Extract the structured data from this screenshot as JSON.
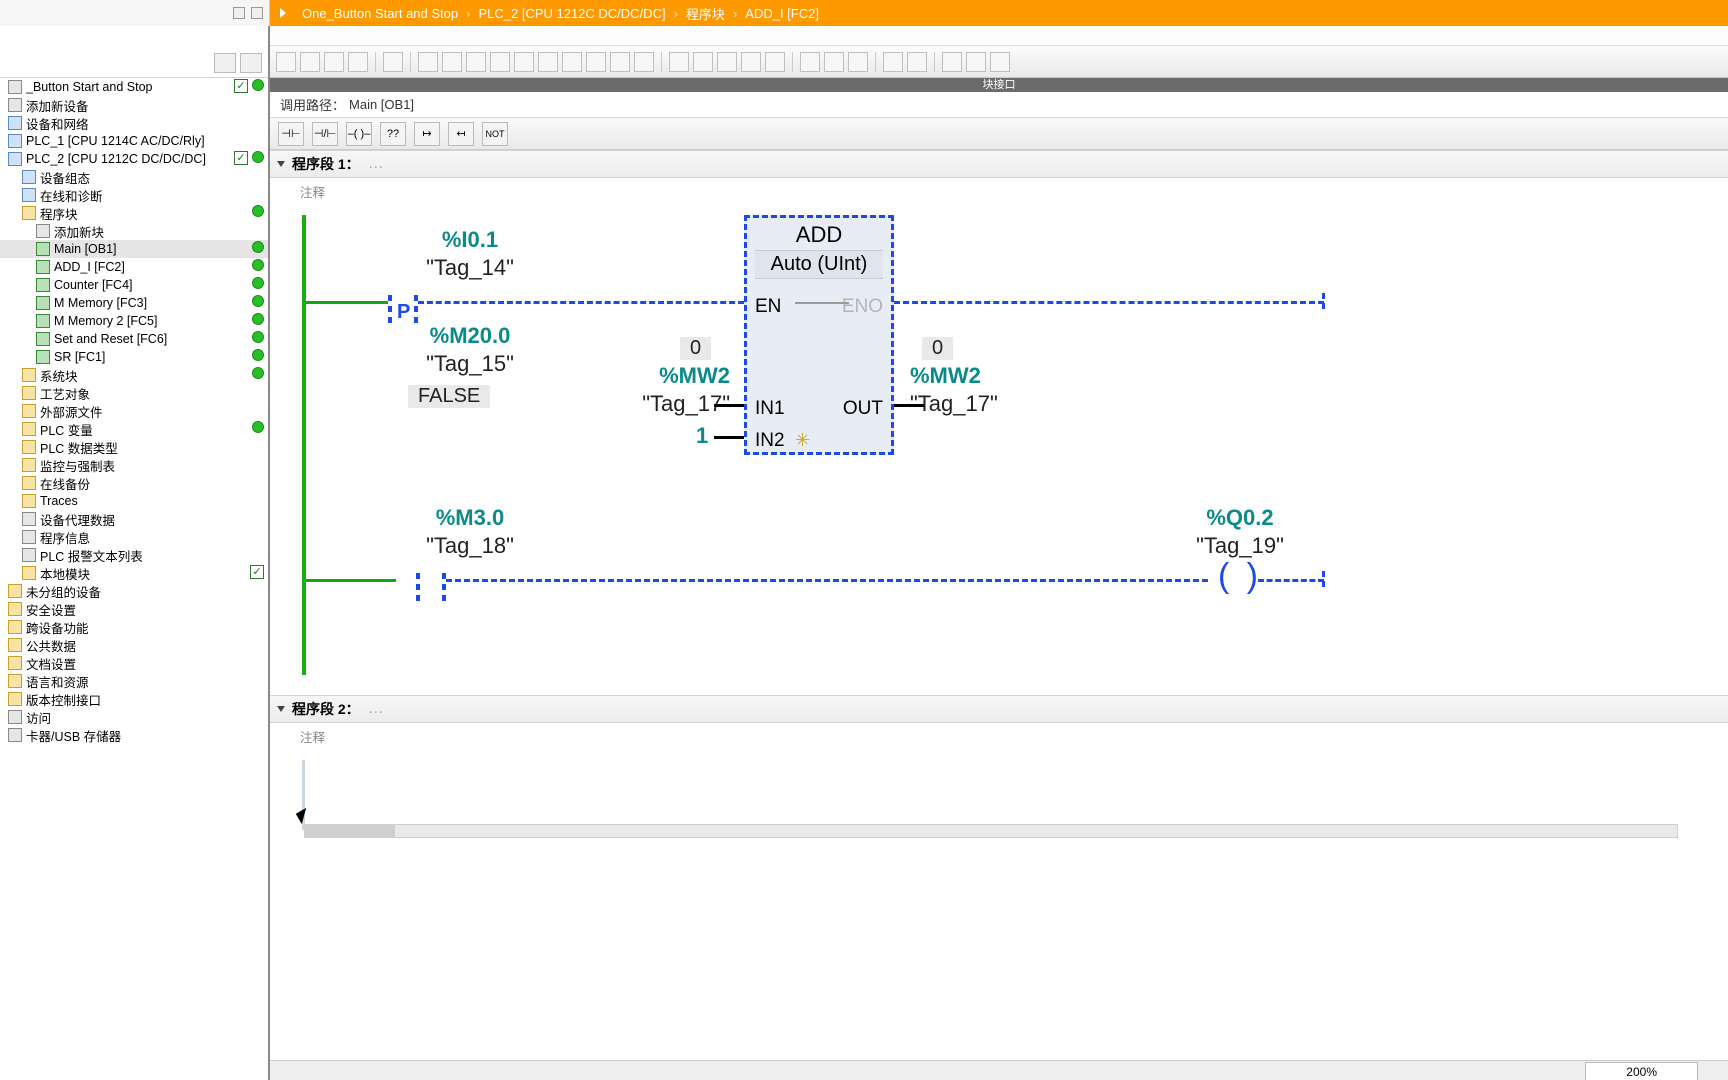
{
  "breadcrumb": {
    "project": "One_Button Start and Stop",
    "device": "PLC_2 [CPU 1212C DC/DC/DC]",
    "folder": "程序块",
    "block": "ADD_I [FC2]"
  },
  "interface_bar": "块接口",
  "call_path_label": "调用路径：",
  "call_path_value": "Main [OB1]",
  "lad_btn_not": "NOT",
  "lad_btn_qmark": "??",
  "tree": [
    {
      "indent": 0,
      "icon": "gray",
      "label": "_Button Start and Stop",
      "check": true,
      "dot": true
    },
    {
      "indent": 0,
      "icon": "gray",
      "label": "添加新设备"
    },
    {
      "indent": 0,
      "icon": "blue",
      "label": "设备和网络"
    },
    {
      "indent": 0,
      "icon": "blue",
      "label": "PLC_1 [CPU 1214C AC/DC/Rly]"
    },
    {
      "indent": 0,
      "icon": "blue",
      "label": "PLC_2 [CPU 1212C DC/DC/DC]",
      "check": true,
      "dot": true
    },
    {
      "indent": 1,
      "icon": "blue",
      "label": "设备组态"
    },
    {
      "indent": 1,
      "icon": "blue",
      "label": "在线和诊断"
    },
    {
      "indent": 1,
      "icon": "folder",
      "label": "程序块",
      "dot": true
    },
    {
      "indent": 2,
      "icon": "gray",
      "label": "添加新块"
    },
    {
      "indent": 2,
      "icon": "block",
      "label": "Main [OB1]",
      "dot": true,
      "selected": true
    },
    {
      "indent": 2,
      "icon": "block",
      "label": "ADD_I  [FC2]",
      "dot": true
    },
    {
      "indent": 2,
      "icon": "block",
      "label": "Counter [FC4]",
      "dot": true
    },
    {
      "indent": 2,
      "icon": "block",
      "label": "M Memory [FC3]",
      "dot": true
    },
    {
      "indent": 2,
      "icon": "block",
      "label": "M Memory 2 [FC5]",
      "dot": true
    },
    {
      "indent": 2,
      "icon": "block",
      "label": "Set and Reset [FC6]",
      "dot": true
    },
    {
      "indent": 2,
      "icon": "block",
      "label": "SR [FC1]",
      "dot": true
    },
    {
      "indent": 1,
      "icon": "folder",
      "label": "系统块",
      "dot": true
    },
    {
      "indent": 1,
      "icon": "folder",
      "label": "工艺对象"
    },
    {
      "indent": 1,
      "icon": "folder",
      "label": "外部源文件"
    },
    {
      "indent": 1,
      "icon": "folder",
      "label": "PLC 变量",
      "dot": true
    },
    {
      "indent": 1,
      "icon": "folder",
      "label": "PLC 数据类型"
    },
    {
      "indent": 1,
      "icon": "folder",
      "label": "监控与强制表"
    },
    {
      "indent": 1,
      "icon": "folder",
      "label": "在线备份"
    },
    {
      "indent": 1,
      "icon": "folder",
      "label": "Traces"
    },
    {
      "indent": 1,
      "icon": "gray",
      "label": "设备代理数据"
    },
    {
      "indent": 1,
      "icon": "gray",
      "label": "程序信息"
    },
    {
      "indent": 1,
      "icon": "gray",
      "label": "PLC 报警文本列表"
    },
    {
      "indent": 1,
      "icon": "folder",
      "label": "本地模块",
      "check": true
    },
    {
      "indent": 0,
      "icon": "folder",
      "label": "未分组的设备"
    },
    {
      "indent": 0,
      "icon": "folder",
      "label": "安全设置"
    },
    {
      "indent": 0,
      "icon": "folder",
      "label": "跨设备功能"
    },
    {
      "indent": 0,
      "icon": "folder",
      "label": "公共数据"
    },
    {
      "indent": 0,
      "icon": "folder",
      "label": "文档设置"
    },
    {
      "indent": 0,
      "icon": "folder",
      "label": "语言和资源"
    },
    {
      "indent": 0,
      "icon": "folder",
      "label": "版本控制接口"
    },
    {
      "indent": 0,
      "icon": "gray",
      "label": "访问"
    },
    {
      "indent": 0,
      "icon": "gray",
      "label": "卡器/USB 存储器"
    }
  ],
  "network1": {
    "title": "程序段 1：",
    "comment": "注释",
    "contact1": {
      "addr": "%I0.1",
      "name": "\"Tag_14\"",
      "modifier": "P"
    },
    "edge_mem": {
      "addr": "%M20.0",
      "name": "\"Tag_15\"",
      "status": "FALSE"
    },
    "box": {
      "title": "ADD",
      "subtitle": "Auto (UInt)",
      "en": "EN",
      "eno": "ENO",
      "in1": "IN1",
      "in2": "IN2",
      "out": "OUT"
    },
    "in1": {
      "val": "0",
      "addr": "%MW2",
      "name": "\"Tag_17\""
    },
    "in2": {
      "literal": "1",
      "star": "✳"
    },
    "out": {
      "val": "0",
      "addr": "%MW2",
      "name": "\"Tag_17\""
    },
    "contact2": {
      "addr": "%M3.0",
      "name": "\"Tag_18\""
    },
    "coil": {
      "addr": "%Q0.2",
      "name": "\"Tag_19\""
    }
  },
  "network2": {
    "title": "程序段 2：",
    "comment": "注释"
  },
  "zoom": "200%"
}
